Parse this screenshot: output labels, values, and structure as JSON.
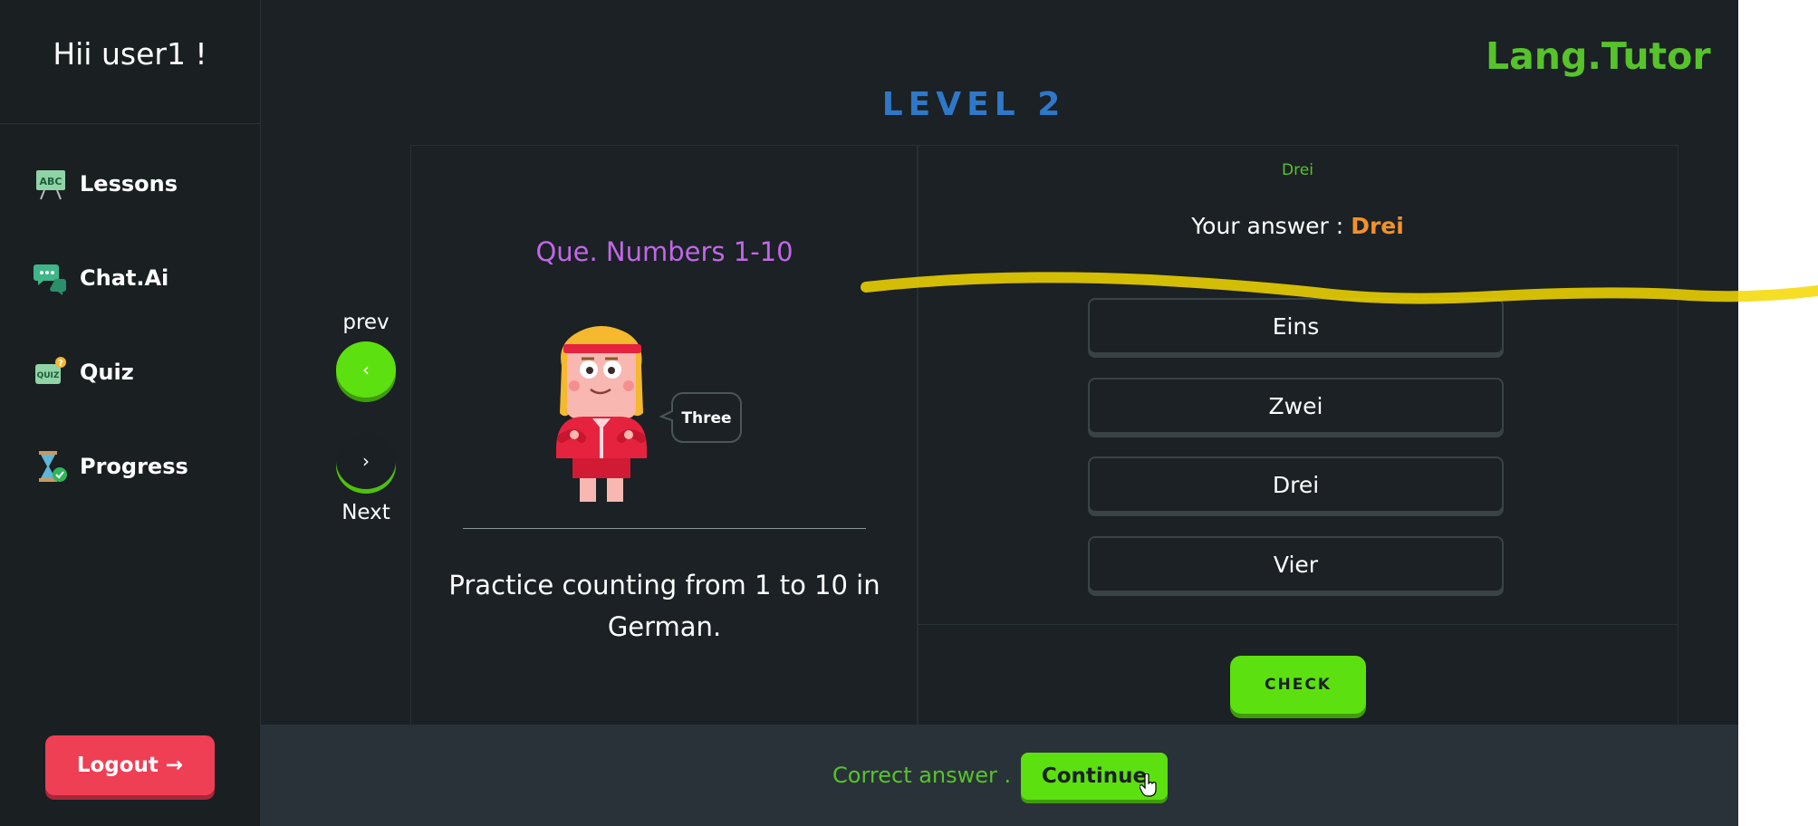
{
  "sidebar": {
    "greeting": "Hii user1 !",
    "items": [
      {
        "label": "Lessons",
        "icon": "abc-board-icon"
      },
      {
        "label": "Chat.Ai",
        "icon": "chat-bubbles-icon"
      },
      {
        "label": "Quiz",
        "icon": "quiz-icon"
      },
      {
        "label": "Progress",
        "icon": "hourglass-check-icon"
      }
    ],
    "logout_label": "Logout →"
  },
  "header": {
    "brand": "Lang.Tutor",
    "level": "LEVEL 2"
  },
  "navigation": {
    "prev_label": "prev",
    "prev_glyph": "‹",
    "next_label": "Next",
    "next_glyph": "›"
  },
  "question": {
    "title": "Que. Numbers 1-10",
    "speech": "Three",
    "description": "Practice counting from 1 to 10 in German."
  },
  "answer": {
    "selected_small": "Drei",
    "your_answer_label": "Your answer :",
    "your_answer_value": "Drei",
    "options": [
      "Eins",
      "Zwei",
      "Drei",
      "Vier"
    ],
    "check_label": "CHECK"
  },
  "result": {
    "message": "Correct answer .",
    "continue_label": "Continue"
  },
  "colors": {
    "background": "#1b2124",
    "accent_green": "#5de00f",
    "brand_green": "#57c32b",
    "level_blue": "#2f78c9",
    "question_purple": "#c167e8",
    "answer_orange": "#f2912b",
    "logout_red": "#ef3f54",
    "highlight_yellow": "#f5d800"
  }
}
